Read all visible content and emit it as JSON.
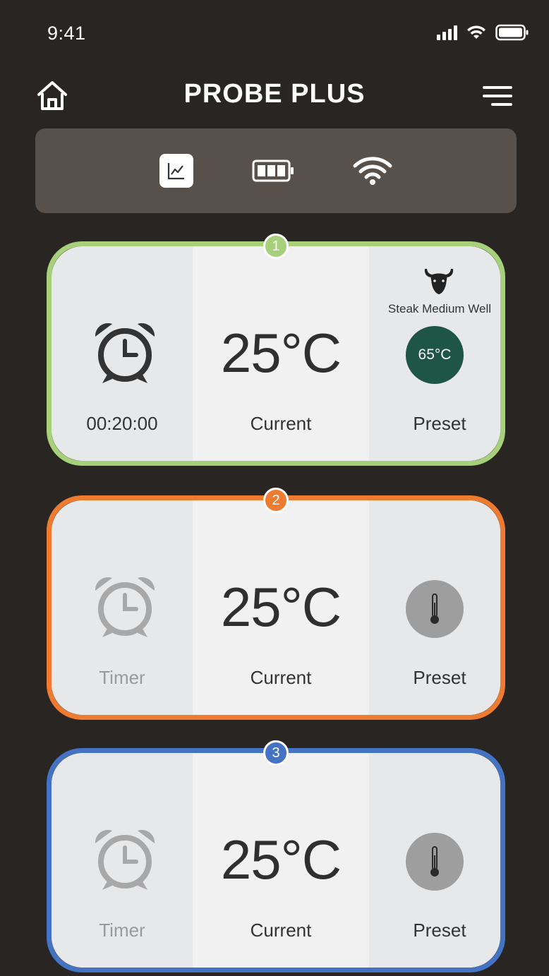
{
  "status": {
    "time": "9:41"
  },
  "header": {
    "title": "PROBE PLUS"
  },
  "toolbar": {
    "items": [
      "chart-icon",
      "battery-icon",
      "wifi-icon"
    ]
  },
  "colors": {
    "probe1": "#a6d07a",
    "probe2": "#ee7b30",
    "probe3": "#4473c3",
    "preset_active": "#1e5544"
  },
  "probes": [
    {
      "number": "1",
      "timer": "00:20:00",
      "temp": "25°C",
      "temp_label": "Current",
      "food": "Steak Medium Well",
      "preset_temp": "65°C",
      "preset_label": "Preset"
    },
    {
      "number": "2",
      "timer": "Timer",
      "temp": "25°C",
      "temp_label": "Current",
      "preset_label": "Preset"
    },
    {
      "number": "3",
      "timer": "Timer",
      "temp": "25°C",
      "temp_label": "Current",
      "preset_label": "Preset"
    }
  ]
}
